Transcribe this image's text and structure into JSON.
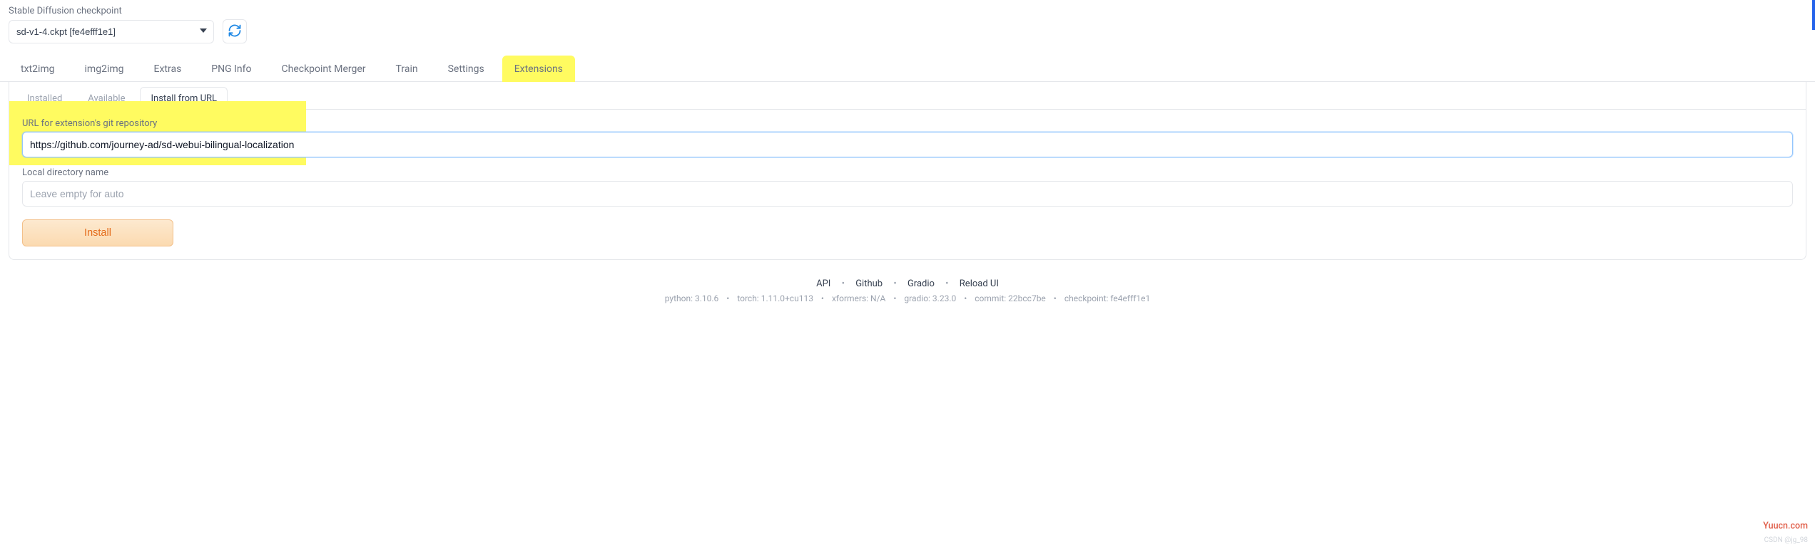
{
  "header": {
    "checkpoint_label": "Stable Diffusion checkpoint",
    "checkpoint_value": "sd-v1-4.ckpt [fe4efff1e1]"
  },
  "main_tabs": [
    {
      "id": "txt2img",
      "label": "txt2img",
      "active": false
    },
    {
      "id": "img2img",
      "label": "img2img",
      "active": false
    },
    {
      "id": "extras",
      "label": "Extras",
      "active": false
    },
    {
      "id": "pnginfo",
      "label": "PNG Info",
      "active": false
    },
    {
      "id": "ckptmerger",
      "label": "Checkpoint Merger",
      "active": false
    },
    {
      "id": "train",
      "label": "Train",
      "active": false
    },
    {
      "id": "settings",
      "label": "Settings",
      "active": false
    },
    {
      "id": "extensions",
      "label": "Extensions",
      "active": true,
      "highlight": true
    }
  ],
  "sub_tabs": [
    {
      "id": "installed",
      "label": "Installed",
      "active": false
    },
    {
      "id": "available",
      "label": "Available",
      "active": false
    },
    {
      "id": "install_from_url",
      "label": "Install from URL",
      "active": true
    }
  ],
  "form": {
    "url_label": "URL for extension's git repository",
    "url_value": "https://github.com/journey-ad/sd-webui-bilingual-localization",
    "localdir_label": "Local directory name",
    "localdir_value": "",
    "localdir_placeholder": "Leave empty for auto",
    "install_label": "Install"
  },
  "footer": {
    "links": [
      {
        "id": "api",
        "label": "API"
      },
      {
        "id": "github",
        "label": "Github"
      },
      {
        "id": "gradio",
        "label": "Gradio"
      },
      {
        "id": "reloadui",
        "label": "Reload UI"
      }
    ],
    "meta": {
      "python": "python: 3.10.6",
      "torch": "torch: 1.11.0+cu113",
      "xformers": "xformers: N/A",
      "gradio": "gradio: 3.23.0",
      "commit": "commit: 22bcc7be",
      "checkpoint": "checkpoint: fe4efff1e1"
    }
  },
  "watermark": {
    "site": "Yuucn.com",
    "csdn": "CSDN @jg_98"
  }
}
